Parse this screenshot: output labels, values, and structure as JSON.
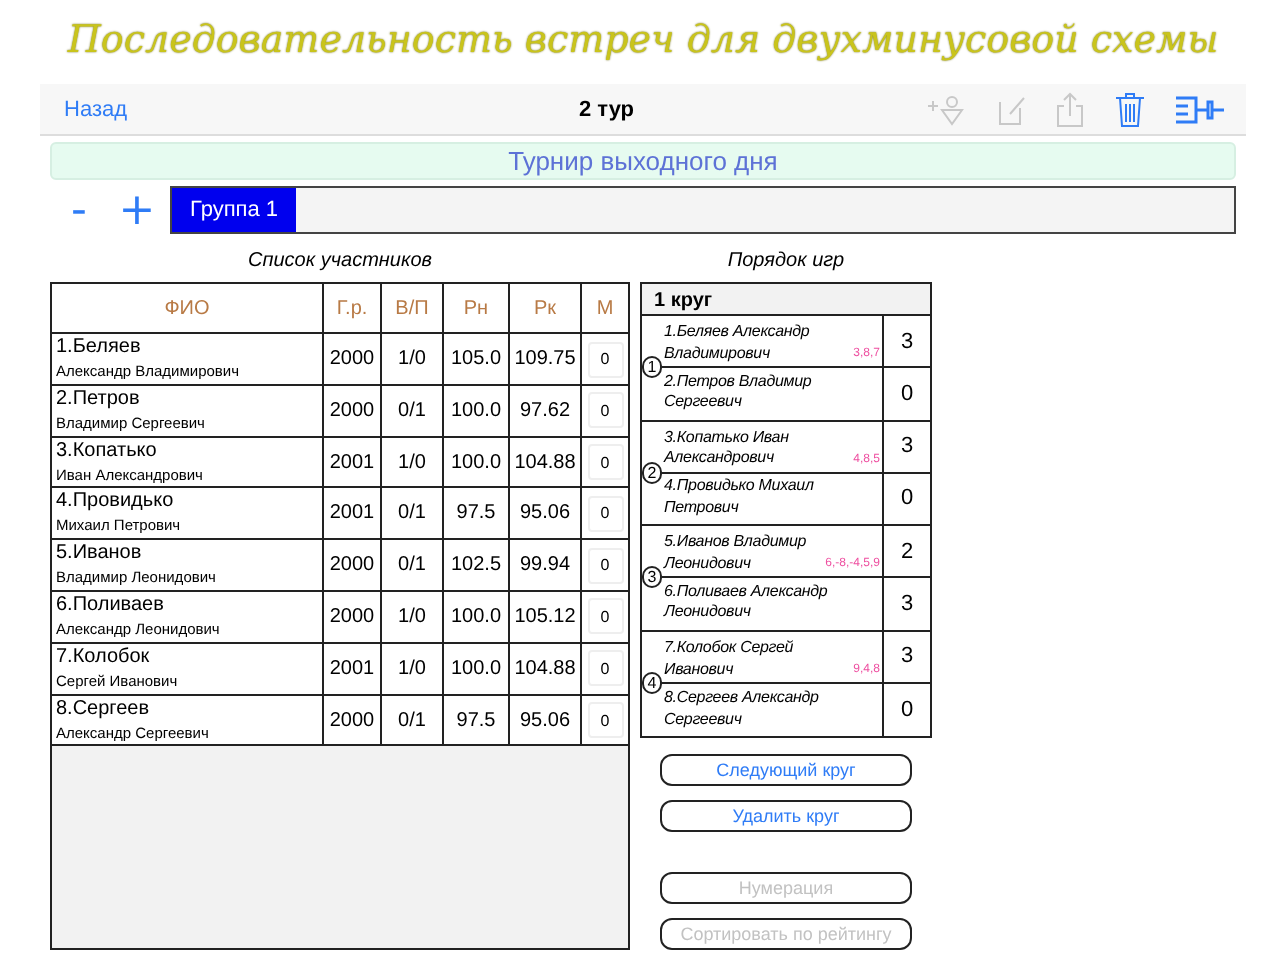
{
  "page_title": "Последовательность встреч для двухминусовой схемы",
  "nav": {
    "back": "Назад",
    "title": "2 тур",
    "tools": [
      {
        "kind": "add-player",
        "disabled": true
      },
      {
        "kind": "edit",
        "disabled": true
      },
      {
        "kind": "share",
        "disabled": true
      },
      {
        "kind": "trash",
        "disabled": false
      },
      {
        "kind": "bracket",
        "disabled": false
      }
    ]
  },
  "tournament": "Турнир выходного дня",
  "group_controls": {
    "minus": "-",
    "plus": "+"
  },
  "tabs": [
    {
      "label": "Группа 1",
      "selected": true
    }
  ],
  "participants": {
    "caption": "Список участников",
    "columns": [
      "ФИО",
      "Г.р.",
      "В/П",
      "Рн",
      "Рк",
      "М"
    ],
    "rows": [
      {
        "name": "1.Беляев",
        "full_name": "Александр Владимирович",
        "year": "2000",
        "wl": "1/0",
        "rn": "105.0",
        "rk": "109.75",
        "m": "0"
      },
      {
        "name": "2.Петров",
        "full_name": "Владимир Сергеевич",
        "year": "2000",
        "wl": "0/1",
        "rn": "100.0",
        "rk": "97.62",
        "m": "0"
      },
      {
        "name": "3.Копатько",
        "full_name": "Иван Александрович",
        "year": "2001",
        "wl": "1/0",
        "rn": "100.0",
        "rk": "104.88",
        "m": "0"
      },
      {
        "name": "4.Провидько",
        "full_name": "Михаил Петрович",
        "year": "2001",
        "wl": "0/1",
        "rn": "97.5",
        "rk": "95.06",
        "m": "0"
      },
      {
        "name": "5.Иванов",
        "full_name": "Владимир Леонидович",
        "year": "2000",
        "wl": "0/1",
        "rn": "102.5",
        "rk": "99.94",
        "m": "0"
      },
      {
        "name": "6.Поливаев",
        "full_name": "Александр Леонидович",
        "year": "2000",
        "wl": "1/0",
        "rn": "100.0",
        "rk": "105.12",
        "m": "0"
      },
      {
        "name": "7.Колобок",
        "full_name": "Сергей Иванович",
        "year": "2001",
        "wl": "1/0",
        "rn": "100.0",
        "rk": "104.88",
        "m": "0"
      },
      {
        "name": "8.Сергеев",
        "full_name": "Александр Сергеевич",
        "year": "2000",
        "wl": "0/1",
        "rn": "97.5",
        "rk": "95.06",
        "m": "0"
      }
    ]
  },
  "order": {
    "caption": "Порядок игр",
    "round": "1 круг",
    "pairs": [
      {
        "number": "1",
        "note": "3,8,7",
        "players": [
          {
            "name": "1.Беляев Александр Владимирович",
            "score": "3"
          },
          {
            "name": "2.Петров Владимир Сергеевич",
            "score": "0"
          }
        ]
      },
      {
        "number": "2",
        "note": "4,8,5",
        "players": [
          {
            "name": "3.Копатько Иван Александрович",
            "score": "3"
          },
          {
            "name": "4.Провидько Михаил Петрович",
            "score": "0"
          }
        ]
      },
      {
        "number": "3",
        "note": "6,-8,-4,5,9",
        "players": [
          {
            "name": "5.Иванов Владимир Леонидович",
            "score": "2"
          },
          {
            "name": "6.Поливаев Александр Леонидович",
            "score": "3"
          }
        ]
      },
      {
        "number": "4",
        "note": "9,4,8",
        "players": [
          {
            "name": "7.Колобок Сергей Иванович",
            "score": "3"
          },
          {
            "name": "8.Сергеев Александр Сергеевич",
            "score": "0"
          }
        ]
      }
    ]
  },
  "buttons": [
    {
      "label": "Следующий круг",
      "disabled": false
    },
    {
      "label": "Удалить круг",
      "disabled": false
    },
    {
      "label": "Нумерация",
      "disabled": true
    },
    {
      "label": "Сортировать по рейтингу",
      "disabled": true
    }
  ]
}
